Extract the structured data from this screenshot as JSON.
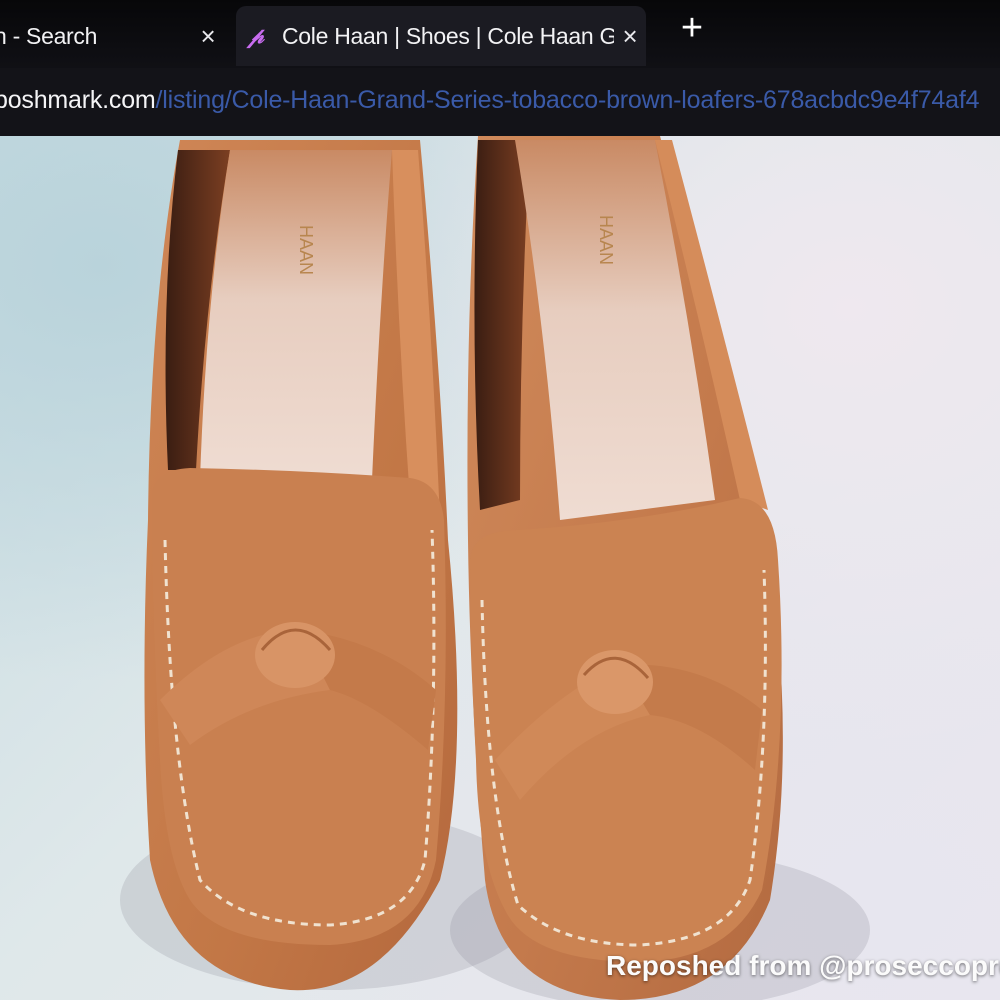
{
  "tabs": [
    {
      "title": "n - Search",
      "close_glyph": "×",
      "favicon": ""
    },
    {
      "title": "Cole Haan | Shoes | Cole Haan G",
      "close_glyph": "×",
      "favicon": "𝓅"
    }
  ],
  "new_tab_glyph": "+",
  "address": {
    "host": "poshmark.com",
    "path": "/listing/Cole-Haan-Grand-Series-tobacco-brown-loafers-678acbdc9e4f74af4"
  },
  "photo": {
    "subject": "two tobacco brown leather loafers with knot detail",
    "insole_brand": "HAAN",
    "overlay_text": "Reposhed from @proseccopro"
  },
  "colors": {
    "tab_bar": "#070709",
    "active_tab": "#1b1b22",
    "url_path": "#3a5aa8",
    "leather": "#c47a4c",
    "insole": "#ead7cc"
  }
}
